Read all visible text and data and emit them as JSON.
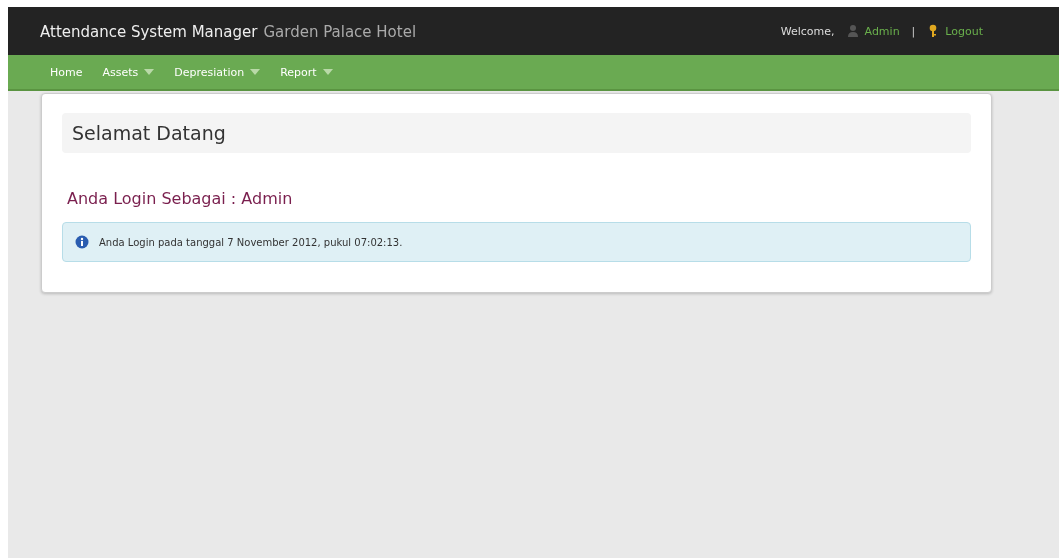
{
  "header": {
    "title": "Attendance System Manager",
    "subtitle": "Garden Palace Hotel",
    "welcome": "Welcome,",
    "user": "Admin",
    "separator": "|",
    "logout": "Logout"
  },
  "nav": [
    {
      "label": "Home",
      "dropdown": false
    },
    {
      "label": "Assets",
      "dropdown": true
    },
    {
      "label": "Depresiation",
      "dropdown": true
    },
    {
      "label": "Report",
      "dropdown": true
    }
  ],
  "content": {
    "heading": "Selamat Datang",
    "role_line": "Anda Login Sebagai : Admin",
    "info": "Anda Login pada tanggal 7 November 2012, pukul 07:02:13."
  }
}
